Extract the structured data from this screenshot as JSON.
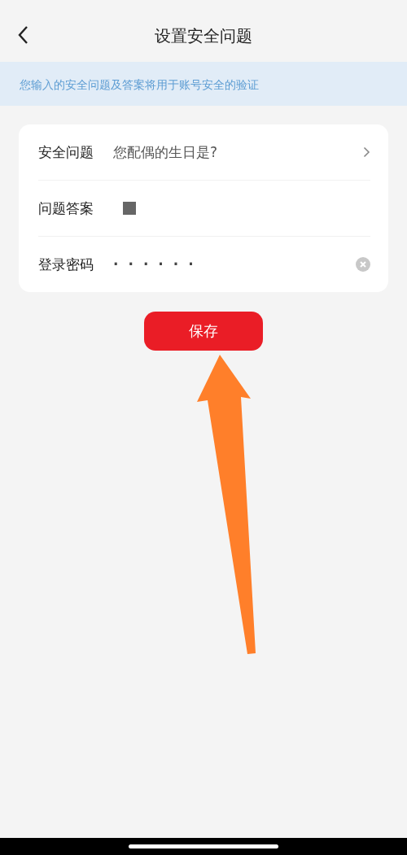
{
  "header": {
    "title": "设置安全问题"
  },
  "notice": "您输入的安全问题及答案将用于账号安全的验证",
  "form": [
    {
      "kind": "select",
      "label": "安全问题",
      "value": "您配偶的生日是?"
    },
    {
      "kind": "answer",
      "label": "问题答案"
    },
    {
      "kind": "password",
      "label": "登录密码",
      "value": "······"
    }
  ],
  "save_button": "保存"
}
